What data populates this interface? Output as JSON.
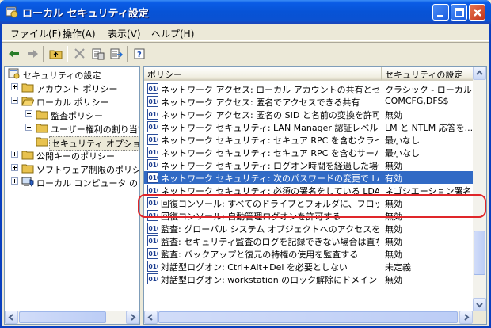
{
  "window": {
    "title": "ローカル セキュリティ設定",
    "icon": "security-settings-icon"
  },
  "menu": {
    "items": [
      "ファイル(F)",
      "操作(A)",
      "表示(V)",
      "ヘルプ(H)"
    ]
  },
  "tree": {
    "items": [
      {
        "label": "セキュリティの設定"
      },
      {
        "label": "アカウント ポリシー"
      },
      {
        "label": "ローカル ポリシー"
      },
      {
        "label": "監査ポリシー"
      },
      {
        "label": "ユーザー権利の割り当て"
      },
      {
        "label": "セキュリティ オプション"
      },
      {
        "label": "公開キーのポリシー"
      },
      {
        "label": "ソフトウェア制限のポリシー"
      },
      {
        "label": "ローカル コンピュータ の IP"
      }
    ]
  },
  "list": {
    "headers": [
      "ポリシー",
      "セキュリティの設定"
    ],
    "rows": [
      {
        "policy": "ネットワーク アクセス: ローカル アカウントの共有とセキュリ...",
        "setting": "クラシック - ローカル ..."
      },
      {
        "policy": "ネットワーク アクセス: 匿名でアクセスできる共有",
        "setting": "COMCFG,DFS$"
      },
      {
        "policy": "ネットワーク アクセス: 匿名の SID と名前の変換を許可す...",
        "setting": "無効"
      },
      {
        "policy": "ネットワーク セキュリティ: LAN Manager 認証レベル",
        "setting": "LM と NTLM 応答を..."
      },
      {
        "policy": "ネットワーク セキュリティ: セキュア RPC を含むクライアント...",
        "setting": "最小なし"
      },
      {
        "policy": "ネットワーク セキュリティ: セキュア RPC を含むサーバー ベ...",
        "setting": "最小なし"
      },
      {
        "policy": "ネットワーク セキュリティ: ログオン時間を経過した場合はユ...",
        "setting": "無効"
      },
      {
        "policy": "ネットワーク セキュリティ: 次のパスワードの変更で LAN マ...",
        "setting": "有効"
      },
      {
        "policy": "ネットワーク セキュリティ: 必須の署名をしている LDAP ク...",
        "setting": "ネゴシエーション署名"
      },
      {
        "policy": "回復コンソール: すべてのドライブとフォルダに、フロッピーの...",
        "setting": "無効"
      },
      {
        "policy": "回復コンソール: 自動管理ログオンを許可する",
        "setting": "無効"
      },
      {
        "policy": "監査: グローバル システム オブジェクトへのアクセスを監査...",
        "setting": "無効"
      },
      {
        "policy": "監査: セキュリティ監査のログを記録できない場合は直ちに...",
        "setting": "無効"
      },
      {
        "policy": "監査: バックアップと復元の特権の使用を監査する",
        "setting": "無効"
      },
      {
        "policy": "対話型ログオン: Ctrl+Alt+Del を必要としない",
        "setting": "未定義"
      },
      {
        "policy": "対話型ログオン: workstation のロック解除にドメイン コン...",
        "setting": "無効"
      }
    ]
  },
  "colors": {
    "title_blue": "#0a5ce6",
    "selection": "#316ac5",
    "highlight_ring": "#e0262a"
  }
}
